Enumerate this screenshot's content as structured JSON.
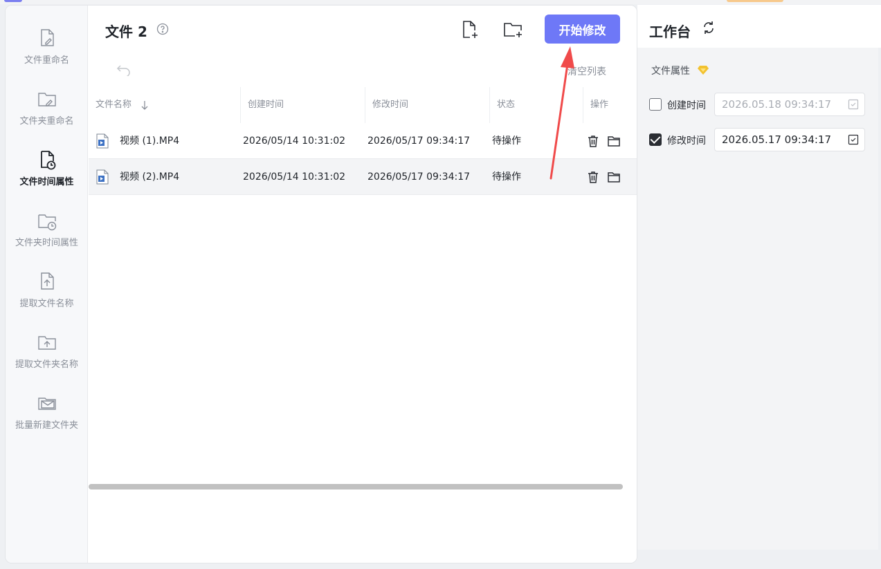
{
  "sidebar": {
    "items": [
      {
        "label": "文件重命名",
        "icon": "file-edit-icon"
      },
      {
        "label": "文件夹重命名",
        "icon": "folder-edit-icon"
      },
      {
        "label": "文件时间属性",
        "icon": "file-clock-icon",
        "active": true
      },
      {
        "label": "文件夹时间属性",
        "icon": "folder-clock-icon"
      },
      {
        "label": "提取文件名称",
        "icon": "file-upload-icon"
      },
      {
        "label": "提取文件夹名称",
        "icon": "folder-upload-icon"
      },
      {
        "label": "批量新建文件夹",
        "icon": "folder-mail-icon"
      }
    ]
  },
  "header": {
    "title": "文件 2",
    "start_button": "开始修改",
    "clear_list": "清空列表"
  },
  "table": {
    "columns": [
      "文件名称",
      "创建时间",
      "修改时间",
      "状态",
      "操作"
    ],
    "rows": [
      {
        "name": "视频 (1).MP4",
        "created": "2026/05/14 10:31:02",
        "modified": "2026/05/17 09:34:17",
        "status": "待操作"
      },
      {
        "name": "视频 (2).MP4",
        "created": "2026/05/14 10:31:02",
        "modified": "2026/05/17 09:34:17",
        "status": "待操作"
      }
    ]
  },
  "workbench": {
    "title": "工作台",
    "section": "文件属性",
    "create_time": {
      "label": "创建时间",
      "value": "2026.05.18 09:34:17",
      "checked": false
    },
    "modify_time": {
      "label": "修改时间",
      "value": "2026.05.17 09:34:17",
      "checked": true
    }
  },
  "colors": {
    "accent": "#6e78f7",
    "badge": "#f2c230"
  }
}
